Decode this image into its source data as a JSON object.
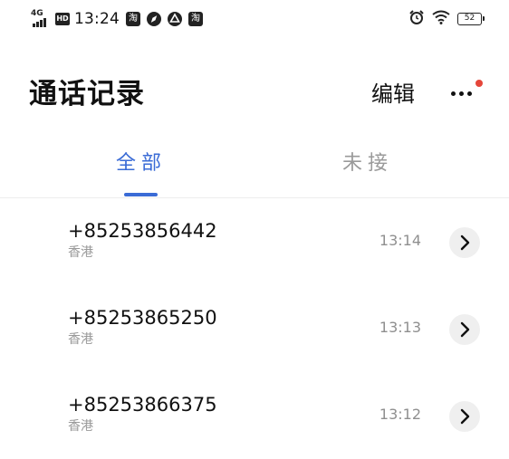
{
  "status_bar": {
    "network": "4G",
    "hd_badge": "HD",
    "time": "13:24",
    "app_icons": [
      "taobao-icon",
      "compass-icon",
      "alipay-icon",
      "taobao-icon"
    ],
    "battery": "52",
    "right_icons": [
      "alarm-icon",
      "wifi-icon",
      "battery-icon"
    ]
  },
  "header": {
    "title": "通话记录",
    "edit_label": "编辑",
    "more_icon": "more-dots-icon",
    "notification_dot_color": "#e5463a"
  },
  "tabs": [
    {
      "label": "全部",
      "active": true
    },
    {
      "label": "未接",
      "active": false
    }
  ],
  "colors": {
    "accent": "#3a6bd6",
    "secondary_text": "#9a9a9a"
  },
  "calls": [
    {
      "number": "+85253856442",
      "location": "香港",
      "time": "13:14",
      "action_icon": "chevron-right-icon"
    },
    {
      "number": "+85253865250",
      "location": "香港",
      "time": "13:13",
      "action_icon": "chevron-right-icon"
    },
    {
      "number": "+85253866375",
      "location": "香港",
      "time": "13:12",
      "action_icon": "chevron-right-icon"
    }
  ]
}
